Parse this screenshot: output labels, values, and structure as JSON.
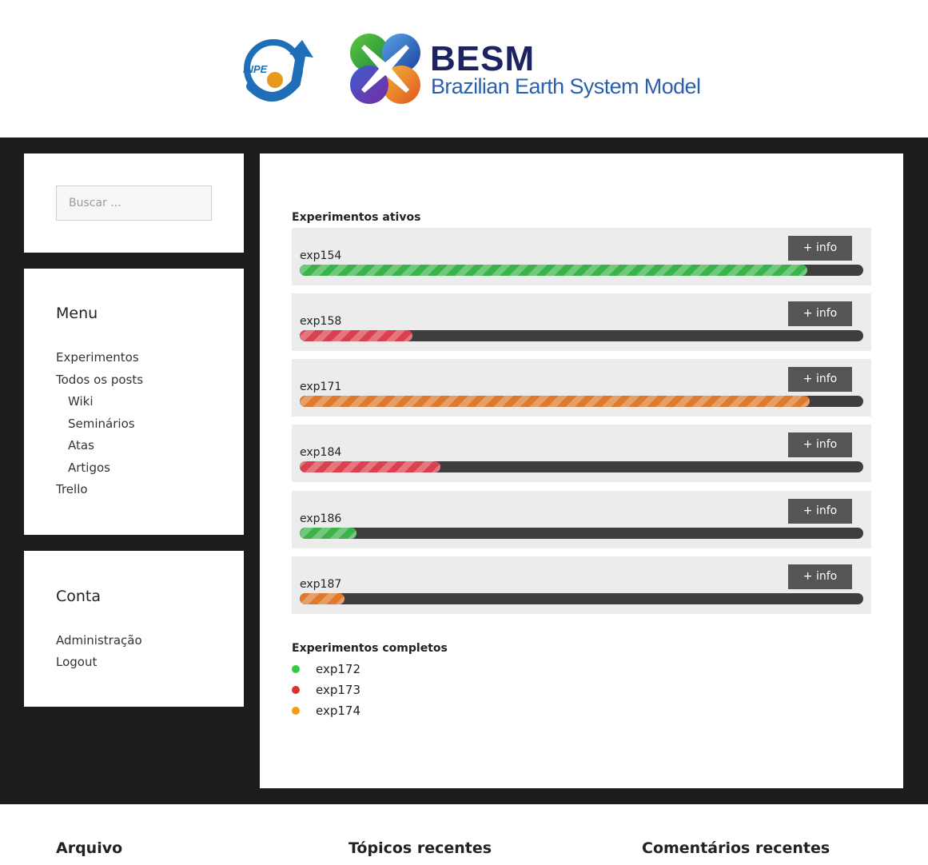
{
  "brand": {
    "inpe_logo_text": "INPE",
    "title": "BESM",
    "subtitle": "Brazilian Earth System Model"
  },
  "search": {
    "placeholder": "Buscar ..."
  },
  "menu": {
    "title": "Menu",
    "items": [
      {
        "label": "Experimentos",
        "sub": false
      },
      {
        "label": "Todos os posts",
        "sub": false
      },
      {
        "label": "Wiki",
        "sub": true
      },
      {
        "label": "Seminários",
        "sub": true
      },
      {
        "label": "Atas",
        "sub": true
      },
      {
        "label": "Artigos",
        "sub": true
      },
      {
        "label": "Trello",
        "sub": false
      }
    ]
  },
  "account": {
    "title": "Conta",
    "items": [
      "Administração",
      "Logout"
    ]
  },
  "active": {
    "title": "Experimentos ativos",
    "button_label": "+ info",
    "experiments": [
      {
        "name": "exp154",
        "progress": 0.9,
        "color": "#3cb34a"
      },
      {
        "name": "exp158",
        "progress": 0.2,
        "color": "#d9414f"
      },
      {
        "name": "exp171",
        "progress": 0.905,
        "color": "#de7a2e"
      },
      {
        "name": "exp184",
        "progress": 0.25,
        "color": "#d9414f"
      },
      {
        "name": "exp186",
        "progress": 0.1,
        "color": "#3cb34a"
      },
      {
        "name": "exp187",
        "progress": 0.08,
        "color": "#de7a2e"
      }
    ]
  },
  "completed": {
    "title": "Experimentos completos",
    "experiments": [
      {
        "name": "exp172",
        "color": "#2ecc40"
      },
      {
        "name": "exp173",
        "color": "#e0312c"
      },
      {
        "name": "exp174",
        "color": "#f39c12"
      }
    ]
  },
  "footer": {
    "archive": "Arquivo",
    "recent_topics": "Tópicos recentes",
    "recent_comments": "Comentários recentes"
  }
}
